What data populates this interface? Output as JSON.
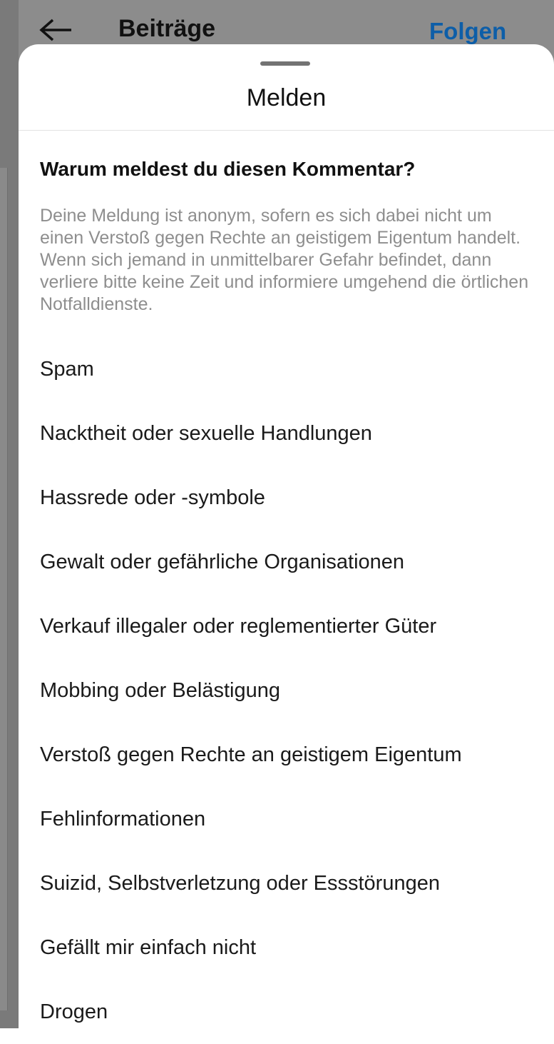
{
  "background": {
    "title": "Beiträge",
    "follow_label": "Folgen"
  },
  "sheet": {
    "title": "Melden",
    "question": "Warum meldest du diesen Kommentar?",
    "description": "Deine Meldung ist anonym, sofern es sich dabei nicht um einen Verstoß gegen Rechte an geistigem Eigentum handelt. Wenn sich jemand in unmittelbarer Gefahr befindet, dann verliere bitte keine Zeit und informiere umgehend die örtlichen Notfalldienste.",
    "reasons": [
      "Spam",
      "Nacktheit oder sexuelle Handlungen",
      "Hassrede oder -symbole",
      "Gewalt oder gefährliche Organisationen",
      "Verkauf illegaler oder reglementierter Güter",
      "Mobbing oder Belästigung",
      "Verstoß gegen Rechte an geistigem Eigentum",
      "Fehlinformationen",
      "Suizid, Selbstverletzung oder Essstörungen",
      "Gefällt mir einfach nicht",
      "Drogen"
    ]
  },
  "colors": {
    "accent": "#0d5ea8",
    "overlay": "#7a7a7a",
    "secondary_text": "#8e8e8e"
  }
}
